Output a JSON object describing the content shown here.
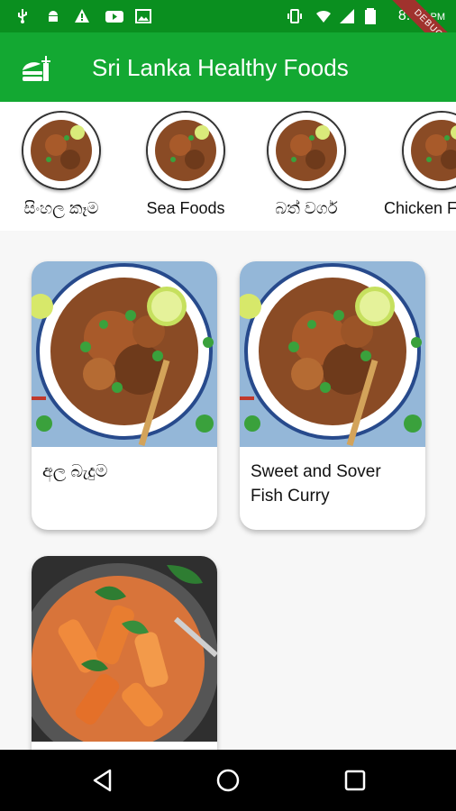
{
  "status_bar": {
    "time": "8:57",
    "ampm": "PM",
    "icons": [
      "usb-icon",
      "android-icon",
      "warning-icon",
      "youtube-icon",
      "image-icon",
      "vibrate-icon",
      "wifi-icon",
      "signal-icon",
      "battery-icon"
    ],
    "debug_label": "DEBUG"
  },
  "app_bar": {
    "title": "Sri Lanka Healthy Foods",
    "logo_icon": "burger-logo-icon"
  },
  "categories": [
    {
      "label": "සිංහල කෑම"
    },
    {
      "label": "Sea Foods"
    },
    {
      "label": "බත් වර්ග"
    },
    {
      "label": "Chicken F"
    }
  ],
  "foods": [
    {
      "name": "අල බැදුම"
    },
    {
      "name": "Sweet and Sover Fish Curry"
    },
    {
      "name": ""
    }
  ],
  "nav_bar": {
    "icons": [
      "back-icon",
      "home-icon",
      "recents-icon"
    ]
  },
  "colors": {
    "status_bar": "#0a8f1f",
    "app_bar": "#13a832",
    "background": "#f7f7f7"
  }
}
